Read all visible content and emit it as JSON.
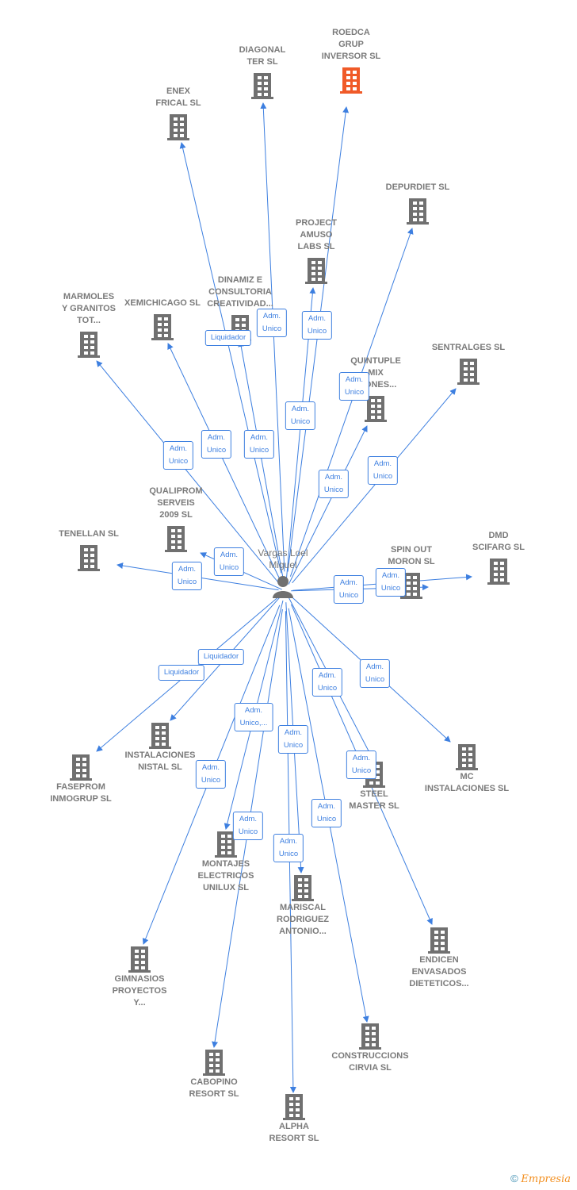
{
  "center": {
    "label": "Vargas Loel\nMiguel",
    "icon": "person-icon"
  },
  "colors": {
    "edge": "#3d7fe0",
    "node": "#707070",
    "highlight": "#f05a28"
  },
  "nodes": [
    {
      "label": "ROEDCA\nGRUP\nINVERSOR  SL",
      "highlight": true,
      "edge": "Adm.\nUnico"
    },
    {
      "label": "DIAGONAL\nTER SL",
      "edge": "Adm.\nUnico"
    },
    {
      "label": "ENEX\nFRICAL SL",
      "edge": "Adm.\nUnico"
    },
    {
      "label": "DEPURDIET SL",
      "edge": "Adm.\nUnico"
    },
    {
      "label": "PROJECT\nAMUSO\nLABS SL",
      "edge": "Adm.\nUnico"
    },
    {
      "label": "DINAMIZ E\nCONSULTORIA\nCREATIVIDAD...",
      "edge": "Liquidador"
    },
    {
      "label": "XEMICHICAGO SL",
      "edge": "Adm.\nUnico"
    },
    {
      "label": "MARMOLES\nY GRANITOS\nTOT...",
      "edge": "Adm.\nUnico"
    },
    {
      "label": "QUINTUPLE\nMIX\n...IONES...",
      "edge": "Adm.\nUnico"
    },
    {
      "label": "SENTRALGES SL",
      "edge": "Adm.\nUnico"
    },
    {
      "label": "QUALIPROM\nSERVEIS\n2009 SL",
      "edge": "Adm.\nUnico"
    },
    {
      "label": "TENELLAN  SL",
      "edge": "Adm.\nUnico"
    },
    {
      "label": "SPIN OUT\nMORON SL",
      "edge": "Adm.\nUnico"
    },
    {
      "label": "DMD\nSCIFARG SL",
      "edge": "Adm.\nUnico"
    },
    {
      "label": "FASEPROM\nINMOGRUP SL",
      "edge": "Liquidador"
    },
    {
      "label": "INSTALACIONES\nNISTAL SL",
      "edge": "Liquidador"
    },
    {
      "label": "MC\nINSTALACIONES SL",
      "edge": "Adm.\nUnico"
    },
    {
      "label": "STEEL\nMASTER SL",
      "edge": "Adm.\nUnico"
    },
    {
      "label": "ENDICEN\nENVASADOS\nDIETETICOS...",
      "edge": "Adm.\nUnico"
    },
    {
      "label": "MONTAJES\nELECTRICOS\nUNILUX SL",
      "edge": "Adm.\nUnico"
    },
    {
      "label": "GIMNASIOS\nPROYECTOS\nY...",
      "edge": "Adm.\nUnico"
    },
    {
      "label": "CABOPINO\nRESORT SL",
      "edge": "Adm.\nUnico,..."
    },
    {
      "label": "MARISCAL\nRODRIGUEZ\nANTONIO...",
      "edge": "Adm.\nUnico"
    },
    {
      "label": "ALPHA\nRESORT SL",
      "edge": "Adm.\nUnico"
    },
    {
      "label": "CONSTRUCCIONS\nCIRVIA SL",
      "edge": "Adm.\nUnico"
    }
  ],
  "footer": {
    "copyright": "©",
    "brand": "Empresia"
  }
}
